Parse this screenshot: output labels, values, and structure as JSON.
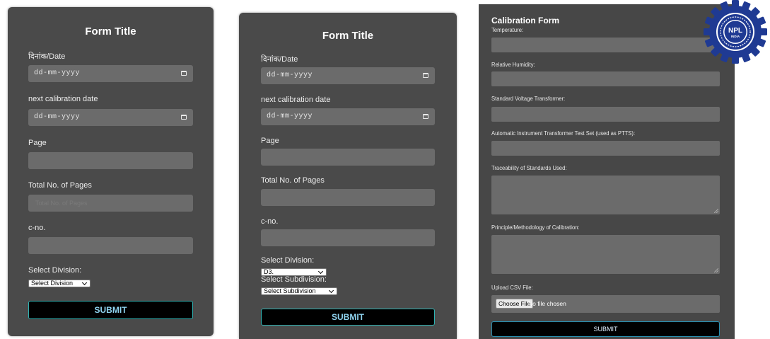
{
  "form1": {
    "title": "Form Title",
    "date_label": "दिनांक/Date",
    "date_value": "dd-mm-yyyy",
    "next_cal_label": "next calibration date",
    "next_cal_value": "dd-mm-yyyy",
    "page_label": "Page",
    "total_pages_label": "Total No. of Pages",
    "total_pages_placeholder": "Total No. of Pages",
    "cno_label": "c-no.",
    "division_label": "Select Division:",
    "division_value": "Select Division",
    "submit_label": "SUBMIT"
  },
  "form2": {
    "title": "Form Title",
    "date_label": "दिनांक/Date",
    "date_value": "dd-mm-yyyy",
    "next_cal_label": "next calibration date",
    "next_cal_value": "dd-mm-yyyy",
    "page_label": "Page",
    "total_pages_label": "Total No. of Pages",
    "cno_label": "c-no.",
    "division_label": "Select Division:",
    "division_value": "D3.",
    "subdivision_label": "Select Subdivision:",
    "subdivision_value": "Select Subdivision",
    "submit_label": "SUBMIT"
  },
  "form3": {
    "title": "Calibration Form",
    "temperature_label": "Temperature:",
    "humidity_label": "Relative Humidity:",
    "svt_label": "Standard Voltage Transformer:",
    "aitts_label": "Automatic Instrument Transformer Test Set (used as PTTS):",
    "traceability_label": "Traceability of Standards Used:",
    "principle_label": "Principle/Methodology of Calibration:",
    "upload_label": "Upload CSV File:",
    "choose_file_label": "Choose File",
    "no_file_label": "No file chosen",
    "submit_label": "SUBMIT"
  },
  "logo": {
    "text": "NPL",
    "subtext": "INDIA"
  },
  "colors": {
    "panel": "#4a4a4a",
    "field": "#6b6b6b",
    "submit_border": "#2fb3b3",
    "submit_text": "#8fd3ef",
    "logo_blue": "#1f3a93"
  }
}
